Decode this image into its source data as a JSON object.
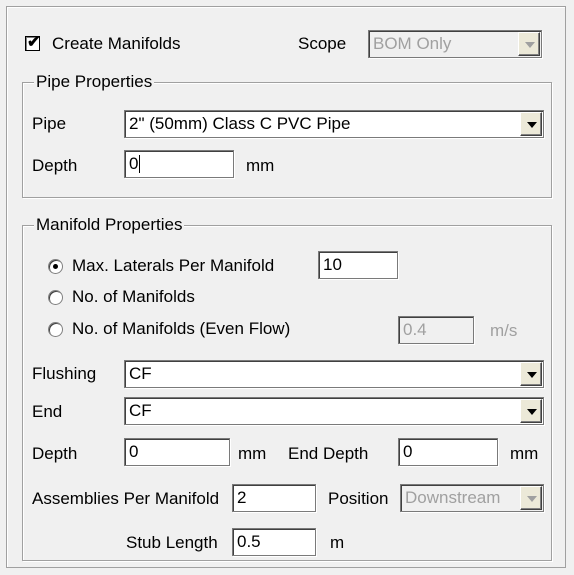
{
  "top": {
    "create_manifolds_label": "Create Manifolds",
    "create_manifolds_checked": true,
    "scope_label": "Scope",
    "scope_value": "BOM Only"
  },
  "pipe_properties": {
    "title": "Pipe Properties",
    "pipe_label": "Pipe",
    "pipe_value": "2\" (50mm) Class C PVC Pipe",
    "depth_label": "Depth",
    "depth_value": "0",
    "depth_unit": "mm"
  },
  "manifold_properties": {
    "title": "Manifold Properties",
    "options": [
      {
        "label": "Max. Laterals Per Manifold",
        "selected": true
      },
      {
        "label": "No. of Manifolds",
        "selected": false
      },
      {
        "label": "No. of Manifolds (Even Flow)",
        "selected": false
      }
    ],
    "max_laterals_value": "10",
    "even_flow_value": "0.4",
    "even_flow_unit": "m/s",
    "flushing_label": "Flushing",
    "flushing_value": "CF",
    "end_label": "End",
    "end_value": "CF",
    "depth_label": "Depth",
    "depth_value": "0",
    "depth_unit": "mm",
    "end_depth_label": "End Depth",
    "end_depth_value": "0",
    "end_depth_unit": "mm",
    "assemblies_label": "Assemblies Per Manifold",
    "assemblies_value": "2",
    "position_label": "Position",
    "position_value": "Downstream",
    "stub_length_label": "Stub Length",
    "stub_length_value": "0.5",
    "stub_length_unit": "m"
  }
}
